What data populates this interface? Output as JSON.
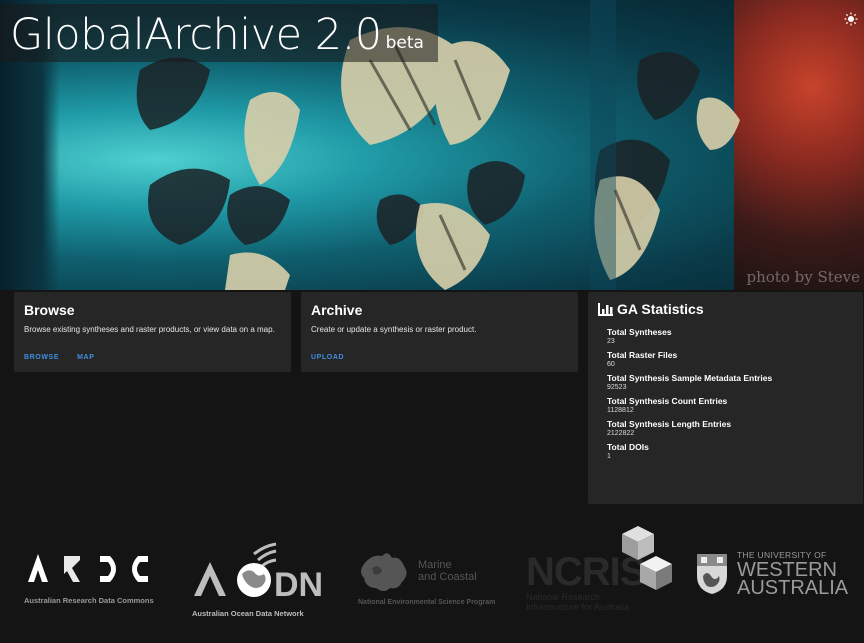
{
  "header": {
    "title": "GlobalArchive 2.0",
    "beta": "beta",
    "photo_credit": "photo by Steve",
    "theme_icon": "sun-icon"
  },
  "browse": {
    "title": "Browse",
    "description": "Browse existing syntheses and raster products, or view data on a map.",
    "actions": [
      "BROWSE",
      "MAP"
    ]
  },
  "archive": {
    "title": "Archive",
    "description": "Create or update a synthesis or raster product.",
    "actions": [
      "UPLOAD"
    ]
  },
  "stats": {
    "icon": "bar-chart-icon",
    "title": "GA Statistics",
    "items": [
      {
        "label": "Total Syntheses",
        "value": "23"
      },
      {
        "label": "Total Raster Files",
        "value": "60"
      },
      {
        "label": "Total Synthesis Sample Metadata Entries",
        "value": "92523"
      },
      {
        "label": "Total Synthesis Count Entries",
        "value": "1128812"
      },
      {
        "label": "Total Synthesis Length Entries",
        "value": "2122822"
      },
      {
        "label": "Total DOIs",
        "value": "1"
      }
    ]
  },
  "logos": {
    "ardc": {
      "name": "Australian Research Data Commons"
    },
    "aodn": {
      "mark": "AODN",
      "name": "Australian Ocean Data Network"
    },
    "nesp": {
      "line1": "Marine",
      "line2": "and Coastal",
      "name": "National Environmental Science Program"
    },
    "ncris": {
      "mark": "NCRIS",
      "line1": "National Research",
      "line2": "Infrastructure for Australia"
    },
    "uwa": {
      "line1": "THE UNIVERSITY OF",
      "line2": "WESTERN",
      "line3": "AUSTRALIA"
    }
  },
  "colors": {
    "accent": "#3f8fe0",
    "card": "#262626",
    "background": "#141414"
  }
}
